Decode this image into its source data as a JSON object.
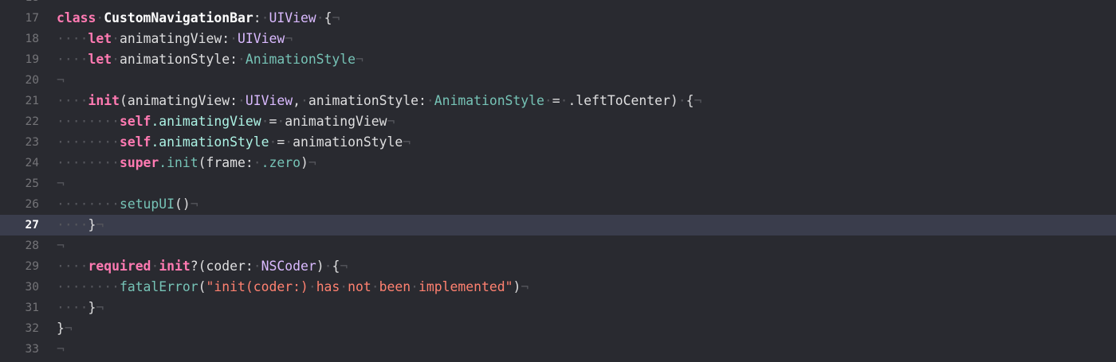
{
  "editor": {
    "theme": {
      "background": "#292a30",
      "current_line": "#3a3d4c",
      "keyword": "#ff7ab2",
      "type": "#76c3b6",
      "string": "#ff8170",
      "invisibles": "#55565c",
      "gutter_text": "#747478"
    },
    "current_line_number": "27",
    "lines": [
      {
        "num": "18",
        "tokens": []
      },
      {
        "num": "17",
        "tokens": [
          {
            "t": "class",
            "c": "kw"
          },
          {
            "t": "·",
            "c": "inv"
          },
          {
            "t": "CustomNavigationBar",
            "c": "decl"
          },
          {
            "t": ":",
            "c": "plain"
          },
          {
            "t": "·",
            "c": "inv"
          },
          {
            "t": "UIView",
            "c": "typeU"
          },
          {
            "t": "·",
            "c": "inv"
          },
          {
            "t": "{",
            "c": "plain"
          },
          {
            "t": "¬",
            "c": "inv"
          }
        ]
      },
      {
        "num": "18",
        "tokens": [
          {
            "t": "····",
            "c": "inv"
          },
          {
            "t": "let",
            "c": "kw"
          },
          {
            "t": "·",
            "c": "inv"
          },
          {
            "t": "animatingView",
            "c": "plain"
          },
          {
            "t": ":",
            "c": "plain"
          },
          {
            "t": "·",
            "c": "inv"
          },
          {
            "t": "UIView",
            "c": "typeU"
          },
          {
            "t": "¬",
            "c": "inv"
          }
        ]
      },
      {
        "num": "19",
        "tokens": [
          {
            "t": "····",
            "c": "inv"
          },
          {
            "t": "let",
            "c": "kw"
          },
          {
            "t": "·",
            "c": "inv"
          },
          {
            "t": "animationStyle",
            "c": "plain"
          },
          {
            "t": ":",
            "c": "plain"
          },
          {
            "t": "·",
            "c": "inv"
          },
          {
            "t": "AnimationStyle",
            "c": "tA"
          },
          {
            "t": "¬",
            "c": "inv"
          }
        ]
      },
      {
        "num": "20",
        "tokens": [
          {
            "t": "¬",
            "c": "inv"
          }
        ]
      },
      {
        "num": "21",
        "tokens": [
          {
            "t": "····",
            "c": "inv"
          },
          {
            "t": "init",
            "c": "kw"
          },
          {
            "t": "(animatingView:",
            "c": "plain"
          },
          {
            "t": "·",
            "c": "inv"
          },
          {
            "t": "UIView",
            "c": "typeU"
          },
          {
            "t": ",",
            "c": "plain"
          },
          {
            "t": "·",
            "c": "inv"
          },
          {
            "t": "animationStyle:",
            "c": "plain"
          },
          {
            "t": "·",
            "c": "inv"
          },
          {
            "t": "AnimationStyle",
            "c": "tA"
          },
          {
            "t": "·",
            "c": "inv"
          },
          {
            "t": "=",
            "c": "plain"
          },
          {
            "t": "·",
            "c": "inv"
          },
          {
            "t": ".leftToCenter)",
            "c": "plain"
          },
          {
            "t": "·",
            "c": "inv"
          },
          {
            "t": "{",
            "c": "plain"
          },
          {
            "t": "¬",
            "c": "inv"
          }
        ]
      },
      {
        "num": "22",
        "tokens": [
          {
            "t": "········",
            "c": "inv"
          },
          {
            "t": "self",
            "c": "kw"
          },
          {
            "t": ".animatingView",
            "c": "prop"
          },
          {
            "t": "·",
            "c": "inv"
          },
          {
            "t": "=",
            "c": "plain"
          },
          {
            "t": "·",
            "c": "inv"
          },
          {
            "t": "animatingView",
            "c": "plain"
          },
          {
            "t": "¬",
            "c": "inv"
          }
        ]
      },
      {
        "num": "23",
        "tokens": [
          {
            "t": "········",
            "c": "inv"
          },
          {
            "t": "self",
            "c": "kw"
          },
          {
            "t": ".animationStyle",
            "c": "prop"
          },
          {
            "t": "·",
            "c": "inv"
          },
          {
            "t": "=",
            "c": "plain"
          },
          {
            "t": "·",
            "c": "inv"
          },
          {
            "t": "animationStyle",
            "c": "plain"
          },
          {
            "t": "¬",
            "c": "inv"
          }
        ]
      },
      {
        "num": "24",
        "tokens": [
          {
            "t": "········",
            "c": "inv"
          },
          {
            "t": "super",
            "c": "kw"
          },
          {
            "t": ".init",
            "c": "fn"
          },
          {
            "t": "(frame:",
            "c": "plain"
          },
          {
            "t": "·",
            "c": "inv"
          },
          {
            "t": ".zero",
            "c": "fn"
          },
          {
            "t": ")",
            "c": "plain"
          },
          {
            "t": "¬",
            "c": "inv"
          }
        ]
      },
      {
        "num": "25",
        "tokens": [
          {
            "t": "¬",
            "c": "inv"
          }
        ]
      },
      {
        "num": "26",
        "tokens": [
          {
            "t": "········",
            "c": "inv"
          },
          {
            "t": "setupUI",
            "c": "fn"
          },
          {
            "t": "()",
            "c": "plain"
          },
          {
            "t": "¬",
            "c": "inv"
          }
        ]
      },
      {
        "num": "27",
        "tokens": [
          {
            "t": "····",
            "c": "inv"
          },
          {
            "t": "}",
            "c": "plain"
          },
          {
            "t": "¬",
            "c": "inv"
          }
        ]
      },
      {
        "num": "28",
        "tokens": [
          {
            "t": "¬",
            "c": "inv"
          }
        ]
      },
      {
        "num": "29",
        "tokens": [
          {
            "t": "····",
            "c": "inv"
          },
          {
            "t": "required",
            "c": "kw"
          },
          {
            "t": "·",
            "c": "inv"
          },
          {
            "t": "init",
            "c": "kw"
          },
          {
            "t": "?(coder:",
            "c": "plain"
          },
          {
            "t": "·",
            "c": "inv"
          },
          {
            "t": "NSCoder",
            "c": "typeU"
          },
          {
            "t": ")",
            "c": "plain"
          },
          {
            "t": "·",
            "c": "inv"
          },
          {
            "t": "{",
            "c": "plain"
          },
          {
            "t": "¬",
            "c": "inv"
          }
        ]
      },
      {
        "num": "30",
        "tokens": [
          {
            "t": "········",
            "c": "inv"
          },
          {
            "t": "fatalError",
            "c": "fn"
          },
          {
            "t": "(",
            "c": "plain"
          },
          {
            "t": "\"init(coder:)",
            "c": "str"
          },
          {
            "t": "·",
            "c": "inv"
          },
          {
            "t": "has",
            "c": "str"
          },
          {
            "t": "·",
            "c": "inv"
          },
          {
            "t": "not",
            "c": "str"
          },
          {
            "t": "·",
            "c": "inv"
          },
          {
            "t": "been",
            "c": "str"
          },
          {
            "t": "·",
            "c": "inv"
          },
          {
            "t": "implemented\"",
            "c": "str"
          },
          {
            "t": ")",
            "c": "plain"
          },
          {
            "t": "¬",
            "c": "inv"
          }
        ]
      },
      {
        "num": "31",
        "tokens": [
          {
            "t": "····",
            "c": "inv"
          },
          {
            "t": "}",
            "c": "plain"
          },
          {
            "t": "¬",
            "c": "inv"
          }
        ]
      },
      {
        "num": "32",
        "tokens": [
          {
            "t": "}",
            "c": "plain"
          },
          {
            "t": "¬",
            "c": "inv"
          }
        ]
      },
      {
        "num": "33",
        "tokens": [
          {
            "t": "¬",
            "c": "inv"
          }
        ]
      }
    ]
  }
}
